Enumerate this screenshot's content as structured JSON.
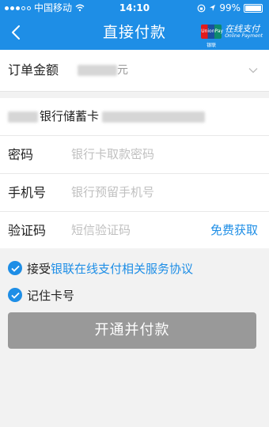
{
  "status_bar": {
    "carrier": "中国移动",
    "time": "14:10",
    "battery": "99%"
  },
  "nav": {
    "title": "直接付款",
    "logo_main": "在线支付",
    "logo_sub": "Online Payment",
    "logo_badge": "UnionPay 银联"
  },
  "order": {
    "label": "订单金额",
    "value_suffix": "元"
  },
  "bank": {
    "name_visible": "银行储蓄卡"
  },
  "form": {
    "password": {
      "label": "密码",
      "placeholder": "银行卡取款密码"
    },
    "phone": {
      "label": "手机号",
      "placeholder": "银行预留手机号"
    },
    "code": {
      "label": "验证码",
      "placeholder": "短信验证码",
      "action": "免费获取"
    }
  },
  "agreement": {
    "prefix": "接受",
    "link": "银联在线支付相关服务协议"
  },
  "remember": {
    "label": "记住卡号"
  },
  "submit": {
    "label": "开通并付款"
  },
  "colors": {
    "primary": "#1e8ee6",
    "button_disabled": "#999999"
  }
}
